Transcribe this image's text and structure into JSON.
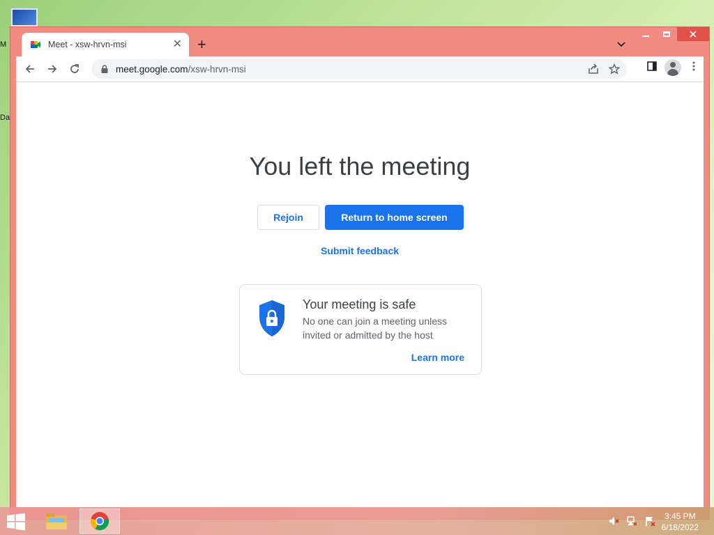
{
  "desktop": {
    "icon_label_1": "M",
    "icon_label_2": "Da"
  },
  "browser": {
    "tab_title": "Meet - xsw-hrvn-msi",
    "url_domain": "meet.google.com",
    "url_path": "/xsw-hrvn-msi"
  },
  "page": {
    "heading": "You left the meeting",
    "rejoin_label": "Rejoin",
    "home_label": "Return to home screen",
    "feedback_label": "Submit feedback",
    "safe_title": "Your meeting is safe",
    "safe_desc": "No one can join a meeting unless invited or admitted by the host",
    "learn_more": "Learn more"
  },
  "taskbar": {
    "time": "3:45 PM",
    "date": "6/18/2022"
  },
  "colors": {
    "accent": "#1a73e8",
    "window_frame": "#f28b82"
  }
}
